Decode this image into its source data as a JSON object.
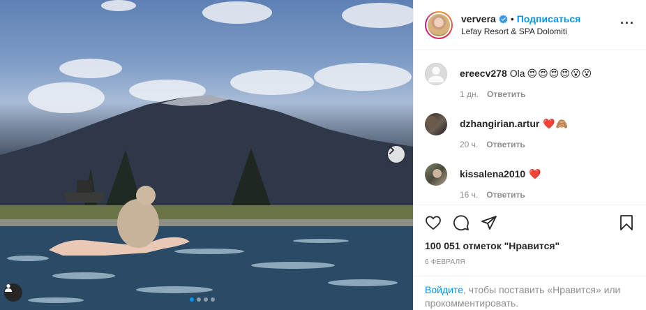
{
  "header": {
    "username": "ververa",
    "separator": "•",
    "follow_label": "Подписаться",
    "location": "Lefay Resort & SPA Dolomiti",
    "more_label": "···"
  },
  "comments": [
    {
      "user": "ereecv278",
      "text": "Ola",
      "emojis": [
        "😍",
        "😍",
        "😍",
        "😍",
        "😮",
        "😮"
      ],
      "time": "1 дн.",
      "reply": "Ответить"
    },
    {
      "user": "dzhangirian.artur",
      "text": "",
      "emojis": [
        "❤️",
        "🙈"
      ],
      "time": "20 ч.",
      "reply": "Ответить"
    },
    {
      "user": "kissalena2010",
      "text": "",
      "emojis": [
        "❤️"
      ],
      "time": "16 ч.",
      "reply": "Ответить"
    }
  ],
  "stats": {
    "likes": "100 051 отметок \"Нравится\"",
    "date": "6 февраля"
  },
  "login": {
    "link": "Войдите",
    "text": ", чтобы поставить «Нравится» или прокомментировать."
  },
  "colors": {
    "accent": "#0095f6",
    "muted": "#8e8e8e",
    "text": "#262626",
    "heart": "#ed4956"
  },
  "icons": [
    "chevron-right-icon",
    "user-tag-icon",
    "verified-badge-icon",
    "heart-icon",
    "comment-icon",
    "share-icon",
    "bookmark-icon",
    "more-icon"
  ]
}
